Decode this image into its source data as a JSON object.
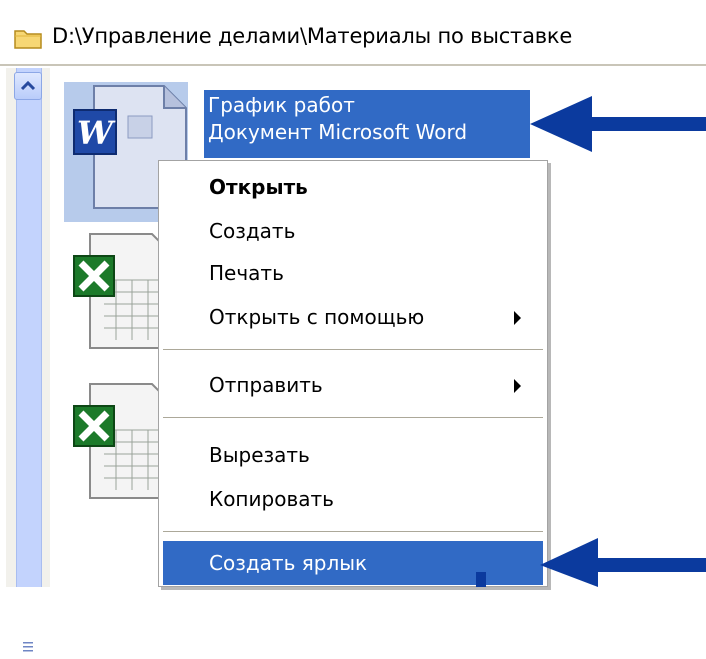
{
  "address_bar": {
    "path": "D:\\Управление делами\\Материалы по выставке"
  },
  "files": [
    {
      "name": "График работ",
      "type": "Документ Microsoft Word",
      "icon": "word-document-icon",
      "selected": true
    },
    {
      "icon": "excel-document-icon"
    },
    {
      "icon": "excel-document-icon"
    }
  ],
  "context_menu": {
    "items": [
      {
        "label": "Открыть",
        "bold": true
      },
      {
        "label": "Создать"
      },
      {
        "label": "Печать"
      },
      {
        "label": "Открыть с помощью",
        "submenu": true
      },
      {
        "label": "Отправить",
        "submenu": true
      },
      {
        "label": "Вырезать"
      },
      {
        "label": "Копировать"
      },
      {
        "label": "Создать ярлык",
        "highlighted": true
      }
    ]
  },
  "colors": {
    "selection": "#316ac5",
    "arrow": "#0b3a9e",
    "scrollbar": "#c3d3fd"
  }
}
